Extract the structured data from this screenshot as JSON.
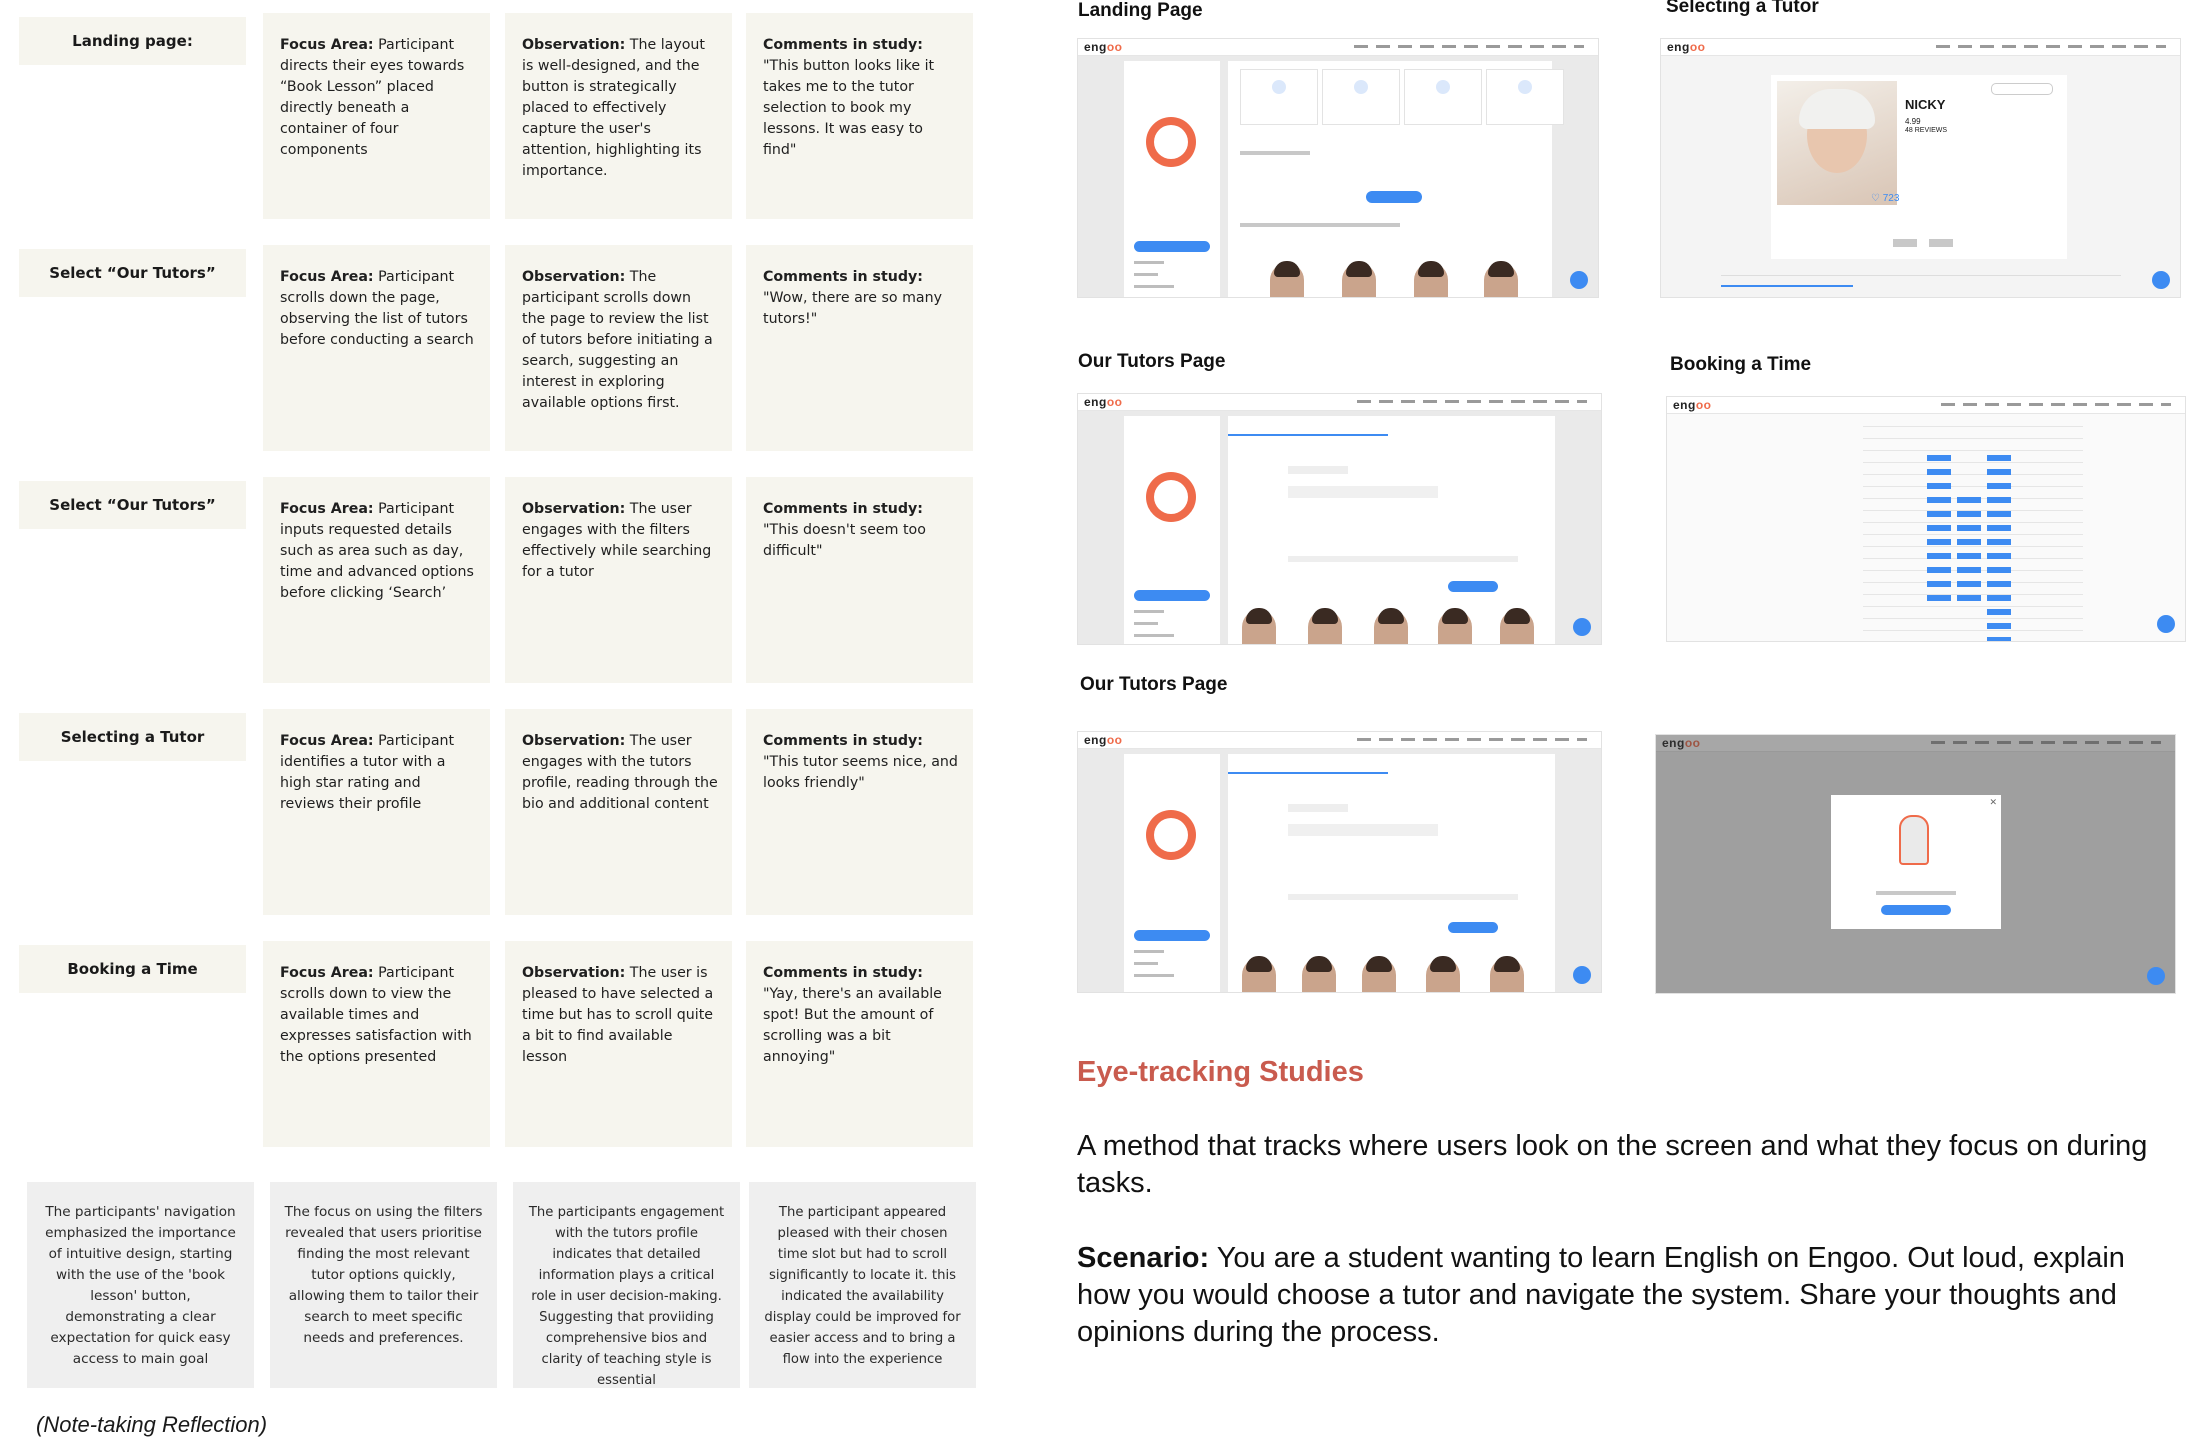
{
  "rows": [
    {
      "label": "Landing page:",
      "focus_label": "Focus Area:",
      "focus_text": " Participant directs their eyes towards “Book Lesson” placed directly beneath a container of four components",
      "obs_label": "Observation:",
      "obs_text": " The layout is well-designed, and the button is strategically placed to effectively capture the user's attention, highlighting its importance.",
      "comment_label": "Comments in study:",
      "comment_text": " \"This button looks like it takes me to the tutor selection to book my lessons. It was easy to find\""
    },
    {
      "label": "Select “Our Tutors”",
      "focus_label": "Focus Area:",
      "focus_text": " Participant scrolls down the page, observing the list of tutors before conducting a search",
      "obs_label": "Observation:",
      "obs_text": " The participant scrolls down the page to review the list of tutors before initiating a search, suggesting an interest in exploring available options first.",
      "comment_label": "Comments in study:",
      "comment_text": " \"Wow, there are so many tutors!\""
    },
    {
      "label": "Select “Our Tutors”",
      "focus_label": "Focus Area:",
      "focus_text": " Participant inputs requested details such as area such as day, time and advanced options before clicking ‘Search’",
      "obs_label": "Observation:",
      "obs_text": "  The user engages with the filters effectively while searching for a tutor",
      "comment_label": "Comments in study:",
      "comment_text": " \"This doesn't seem too difficult\""
    },
    {
      "label": "Selecting a Tutor",
      "focus_label": "Focus Area:",
      "focus_text": " Participant identifies a tutor with a high star rating and reviews their profile",
      "obs_label": "Observation:",
      "obs_text": " The user engages with the tutors profile, reading through the bio and additional content",
      "comment_label": "Comments in study:",
      "comment_text": " \"This tutor seems nice, and looks friendly\""
    },
    {
      "label": "Booking a Time",
      "focus_label": "Focus Area:",
      "focus_text": " Participant scrolls down to view the available times and expresses satisfaction with the options presented",
      "obs_label": "Observation:",
      "obs_text": " The user is pleased to have selected a time but has to scroll quite a bit to find available lesson",
      "comment_label": "Comments in study:",
      "comment_text": " \"Yay, there's an available spot! But the amount of scrolling was a bit annoying\""
    }
  ],
  "reflections": [
    "The participants' navigation emphasized the importance of intuitive design, starting with the use of the 'book lesson' button, demonstrating a clear expectation for quick easy access to main goal",
    "The focus on using the filters revealed that users prioritise finding the most relevant tutor options quickly, allowing them to tailor their search to meet specific needs and preferences.",
    "The participants engagement with the tutors profile indicates that detailed information plays a critical role in user decision-making. Suggesting that proviiding comprehensive bios and clarity of teaching style is essential",
    "The participant appeared pleased with their chosen time slot but had to scroll significantly to locate it. this indicated the availability display could be improved for easier access and to bring a flow into the experience"
  ],
  "caption": "(Note-taking Reflection)",
  "screens": {
    "landing_title": "Landing Page",
    "selecting_title": "Selecting a Tutor",
    "tutors_title_1": "Our Tutors Page",
    "booking_title": "Booking a Time",
    "tutors_title_2": "Our Tutors Page",
    "logo_prefix": "eng",
    "logo_suffix": "oo",
    "tutor_name": "NICKY",
    "tutor_rating": "4.99",
    "tutor_reviews": "48 REVIEWS",
    "tutor_likes": "♡ 723"
  },
  "eye_tracking": {
    "title": "Eye-tracking Studies",
    "description": "A method that tracks where users look on the screen and what they focus on during tasks.",
    "scenario_label": "Scenario:",
    "scenario_text": " You are a student wanting to learn English on Engoo. Out loud, explain how you would choose a tutor and navigate the system. Share your thoughts and opinions during the process."
  },
  "colors": {
    "card_bg": "#f6f5ee",
    "reflection_bg": "#efefef",
    "accent_blue": "#3d8bf2",
    "brand_orange": "#ef6b4a",
    "heading_red": "#c95b4e"
  }
}
